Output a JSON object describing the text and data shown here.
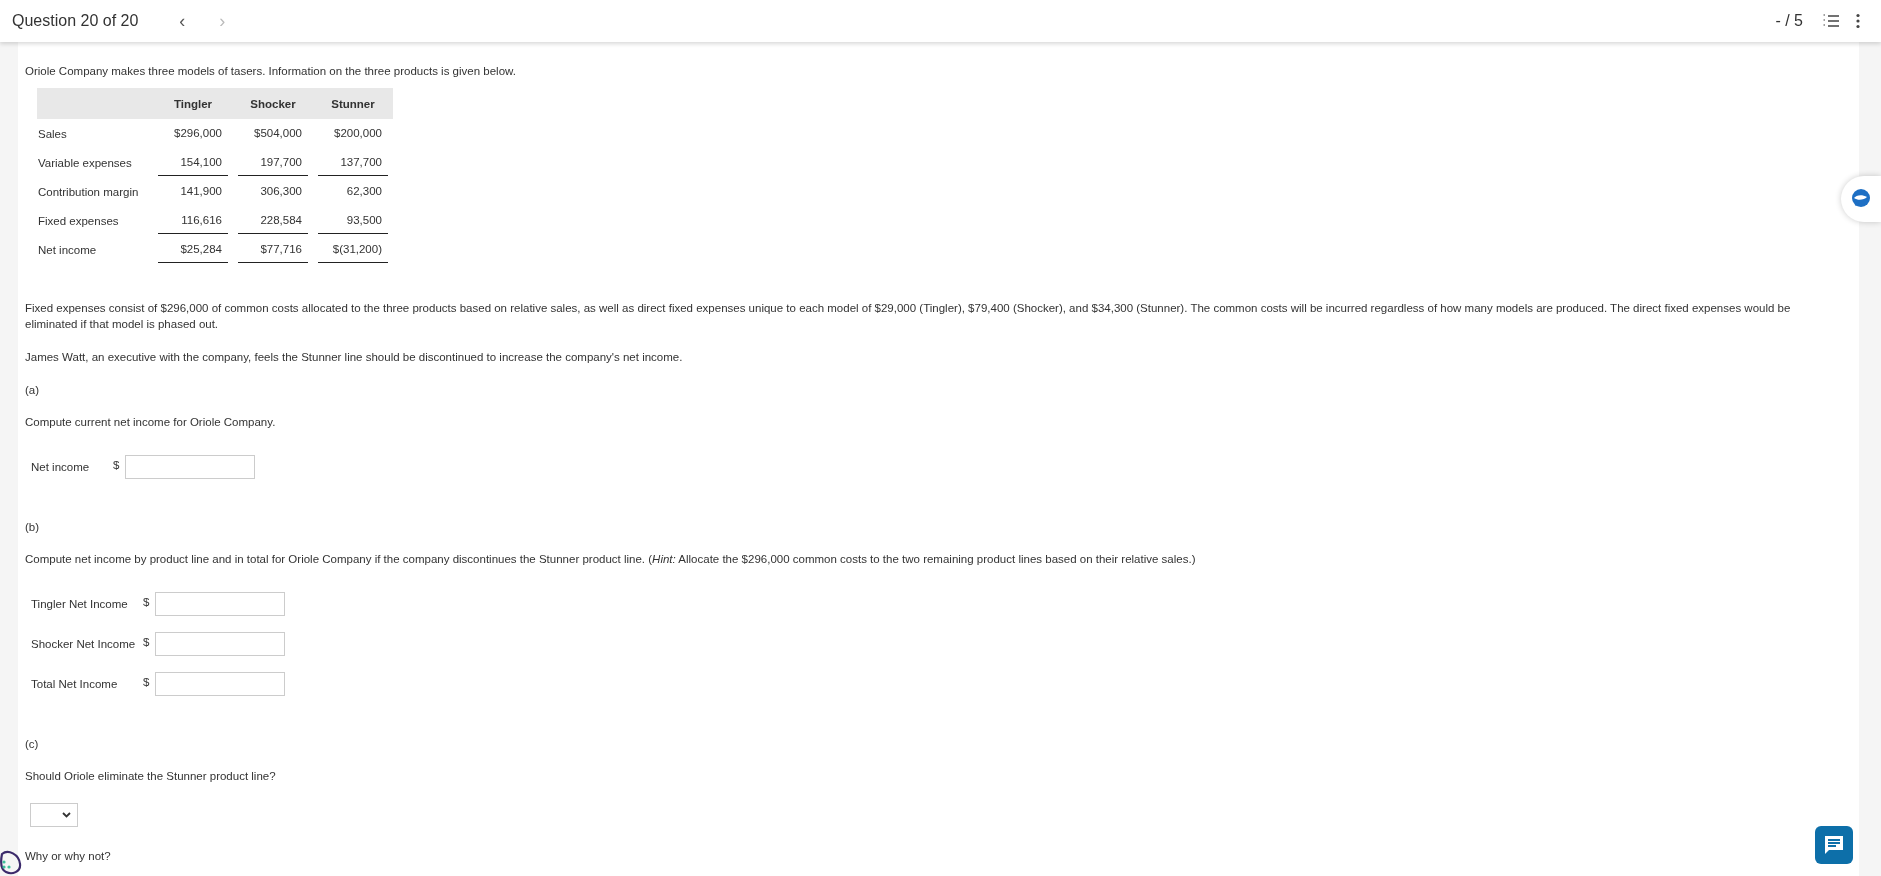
{
  "header": {
    "title": "Question 20 of 20",
    "prev": "‹",
    "next": "›",
    "score": "- / 5"
  },
  "intro": "Oriole Company makes three models of tasers. Information on the three products is given below.",
  "table": {
    "columns": [
      "Tingler",
      "Shocker",
      "Stunner"
    ],
    "rows": [
      {
        "label": "Sales",
        "values": [
          "$296,000",
          "$504,000",
          "$200,000"
        ],
        "underline": false
      },
      {
        "label": "Variable expenses",
        "values": [
          "154,100",
          "197,700",
          "137,700"
        ],
        "underline": true
      },
      {
        "label": "Contribution margin",
        "values": [
          "141,900",
          "306,300",
          "62,300"
        ],
        "underline": false
      },
      {
        "label": "Fixed expenses",
        "values": [
          "116,616",
          "228,584",
          "93,500"
        ],
        "underline": true
      },
      {
        "label": "Net income",
        "values": [
          "$25,284",
          "$77,716",
          "$(31,200)"
        ],
        "underline": true
      }
    ]
  },
  "paragraphs": [
    "Fixed expenses consist of $296,000 of common costs allocated to the three products based on relative sales, as well as direct fixed expenses unique to each model of $29,000 (Tingler), $79,400 (Shocker), and $34,300 (Stunner). The common costs will be incurred regardless of how many models are produced. The direct fixed expenses would be eliminated if that model is phased out.",
    "James Watt, an executive with the company, feels the Stunner line should be discontinued to increase the company's net income."
  ],
  "parts": [
    {
      "label": "(a)",
      "prompt": "Compute current net income for Oriole Company.",
      "fields": [
        {
          "label": "Net income",
          "prefix": "$"
        }
      ]
    },
    {
      "label": "(b)",
      "prompt": "Compute net income by product line and in total for Oriole Company if the company discontinues the Stunner product line. (*Hint:* Allocate the $296,000 common costs to the two remaining product lines based on their relative sales.)",
      "fields": [
        {
          "label": "Tingler Net Income",
          "prefix": "$"
        },
        {
          "label": "Shocker Net Income",
          "prefix": "$"
        },
        {
          "label": "Total Net Income",
          "prefix": "$"
        }
      ]
    },
    {
      "label": "(c)",
      "prompt": "Should Oriole eliminate the Stunner product line?",
      "dropdown": true,
      "followup": "Why or why not?"
    }
  ]
}
